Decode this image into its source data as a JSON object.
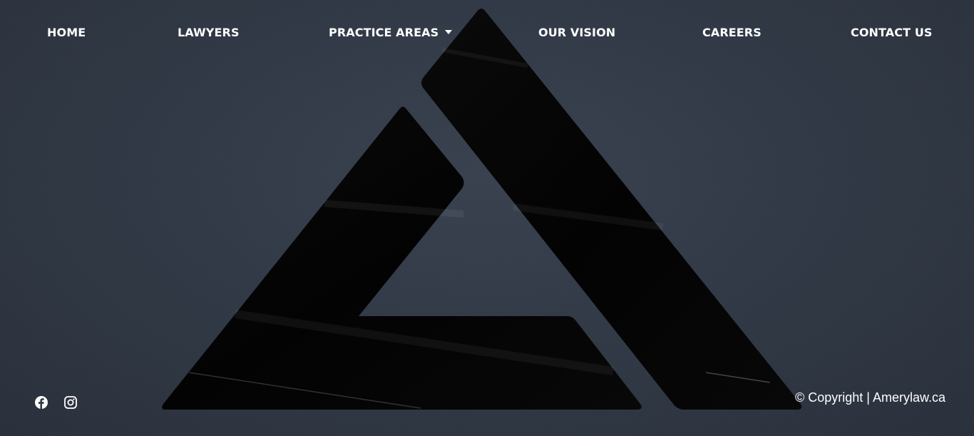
{
  "nav": {
    "home": "HOME",
    "lawyers": "LAWYERS",
    "practice_areas": "PRACTICE AREAS",
    "our_vision": "OUR VISION",
    "careers": "CAREERS",
    "contact_us": "CONTACT US"
  },
  "social": {
    "facebook_icon": "facebook-icon",
    "instagram_icon": "instagram-icon"
  },
  "footer": {
    "copyright": "© Copyright | Amerylaw.ca"
  },
  "colors": {
    "background": "#323a47",
    "logo": "#050505",
    "text": "#ffffff"
  }
}
